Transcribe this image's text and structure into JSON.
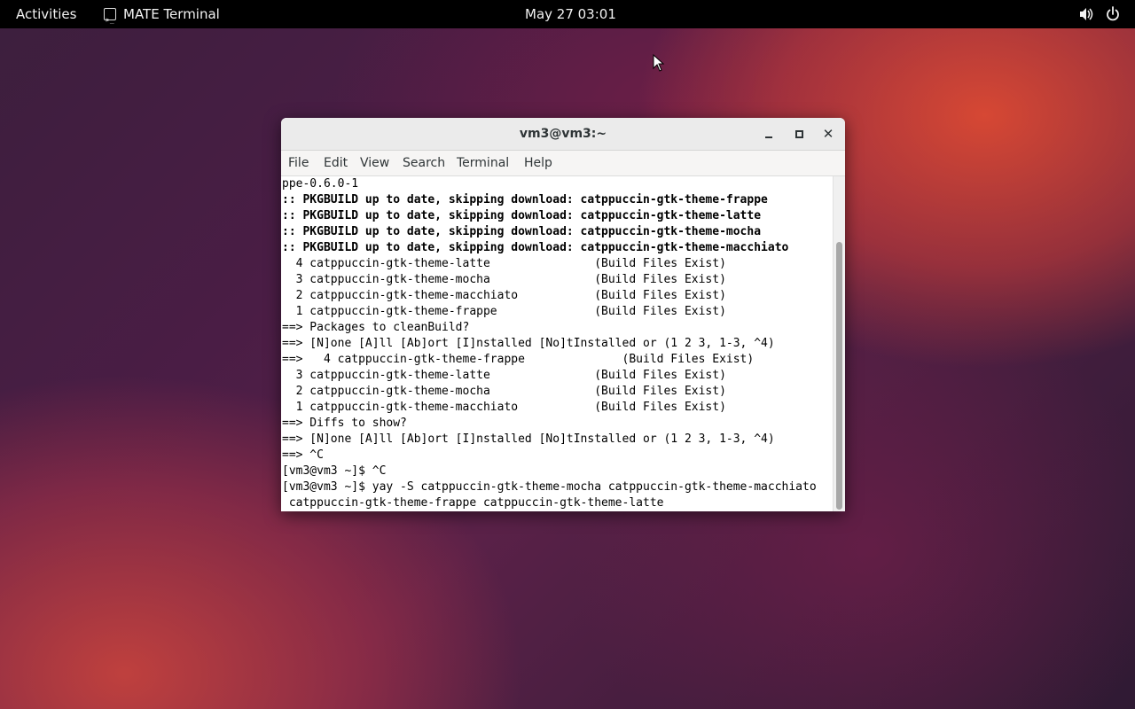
{
  "topbar": {
    "activities": "Activities",
    "app_name": "MATE Terminal",
    "clock": "May 27  03:01",
    "volume_icon": "volume-icon",
    "power_icon": "power-icon"
  },
  "window": {
    "title": "vm3@vm3:~",
    "buttons": {
      "minimize": "minimize-icon",
      "maximize": "maximize-icon",
      "close_glyph": "✕"
    }
  },
  "menubar": {
    "items": [
      "File",
      "Edit",
      "View",
      "Search",
      "Terminal",
      "Help"
    ]
  },
  "terminal": {
    "lines": [
      "ppe-0.6.0-1",
      ":: PKGBUILD up to date, skipping download: catppuccin-gtk-theme-frappe",
      ":: PKGBUILD up to date, skipping download: catppuccin-gtk-theme-latte",
      ":: PKGBUILD up to date, skipping download: catppuccin-gtk-theme-mocha",
      ":: PKGBUILD up to date, skipping download: catppuccin-gtk-theme-macchiato",
      "  4 catppuccin-gtk-theme-latte               (Build Files Exist)",
      "  3 catppuccin-gtk-theme-mocha               (Build Files Exist)",
      "  2 catppuccin-gtk-theme-macchiato           (Build Files Exist)",
      "  1 catppuccin-gtk-theme-frappe              (Build Files Exist)",
      "==> Packages to cleanBuild?",
      "==> [N]one [A]ll [Ab]ort [I]nstalled [No]tInstalled or (1 2 3, 1-3, ^4)",
      "==>   4 catppuccin-gtk-theme-frappe              (Build Files Exist)",
      "  3 catppuccin-gtk-theme-latte               (Build Files Exist)",
      "  2 catppuccin-gtk-theme-mocha               (Build Files Exist)",
      "  1 catppuccin-gtk-theme-macchiato           (Build Files Exist)",
      "==> Diffs to show?",
      "==> [N]one [A]ll [Ab]ort [I]nstalled [No]tInstalled or (1 2 3, 1-3, ^4)",
      "==> ^C",
      "[vm3@vm3 ~]$ ^C",
      "[vm3@vm3 ~]$ yay -S catppuccin-gtk-theme-mocha catppuccin-gtk-theme-macchiato",
      " catppuccin-gtk-theme-frappe catppuccin-gtk-theme-latte"
    ]
  },
  "colors": {
    "topbar": "#000000",
    "titlebar": "#ebebeb",
    "terminal_bg": "#ffffff",
    "terminal_fg": "#000000"
  }
}
